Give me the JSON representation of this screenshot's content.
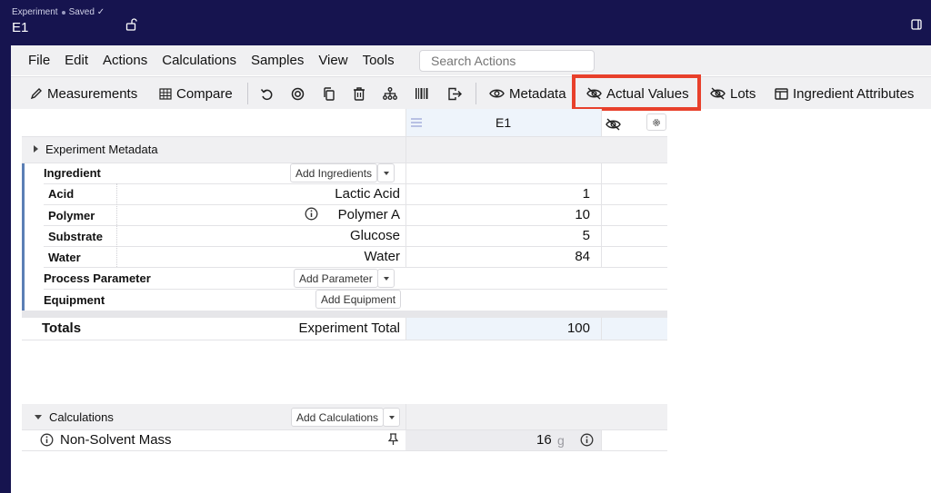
{
  "header": {
    "status_label": "Experiment",
    "status_saved": "Saved ✓",
    "experiment_name": "E1"
  },
  "menu": {
    "items": [
      "File",
      "Edit",
      "Actions",
      "Calculations",
      "Samples",
      "View",
      "Tools"
    ],
    "search_placeholder": "Search Actions"
  },
  "toolbar": {
    "measurements": "Measurements",
    "compare": "Compare",
    "metadata": "Metadata",
    "actual_values": "Actual Values",
    "lots": "Lots",
    "ingredient_attributes": "Ingredient Attributes"
  },
  "grid": {
    "column_header": "E1",
    "metadata_section": "Experiment Metadata",
    "ingredient_label": "Ingredient",
    "add_ingredients": "Add Ingredients",
    "ingredients": [
      {
        "role": "Acid",
        "name": "Lactic Acid",
        "value": "1"
      },
      {
        "role": "Polymer",
        "name": "Polymer A",
        "value": "10"
      },
      {
        "role": "Substrate",
        "name": "Glucose",
        "value": "5"
      },
      {
        "role": "Water",
        "name": "Water",
        "value": "84"
      }
    ],
    "process_parameter_label": "Process Parameter",
    "add_parameter": "Add Parameter",
    "equipment_label": "Equipment",
    "add_equipment": "Add Equipment",
    "totals_label": "Totals",
    "experiment_total_label": "Experiment Total",
    "experiment_total_value": "100",
    "calculations_label": "Calculations",
    "add_calculations": "Add Calculations",
    "calc_name": "Non-Solvent Mass",
    "calc_value": "16",
    "calc_unit": "g"
  },
  "colors": {
    "header_bg": "#16144f",
    "highlight": "#e8402b",
    "ingredient_bar": "#5b7fb5"
  }
}
